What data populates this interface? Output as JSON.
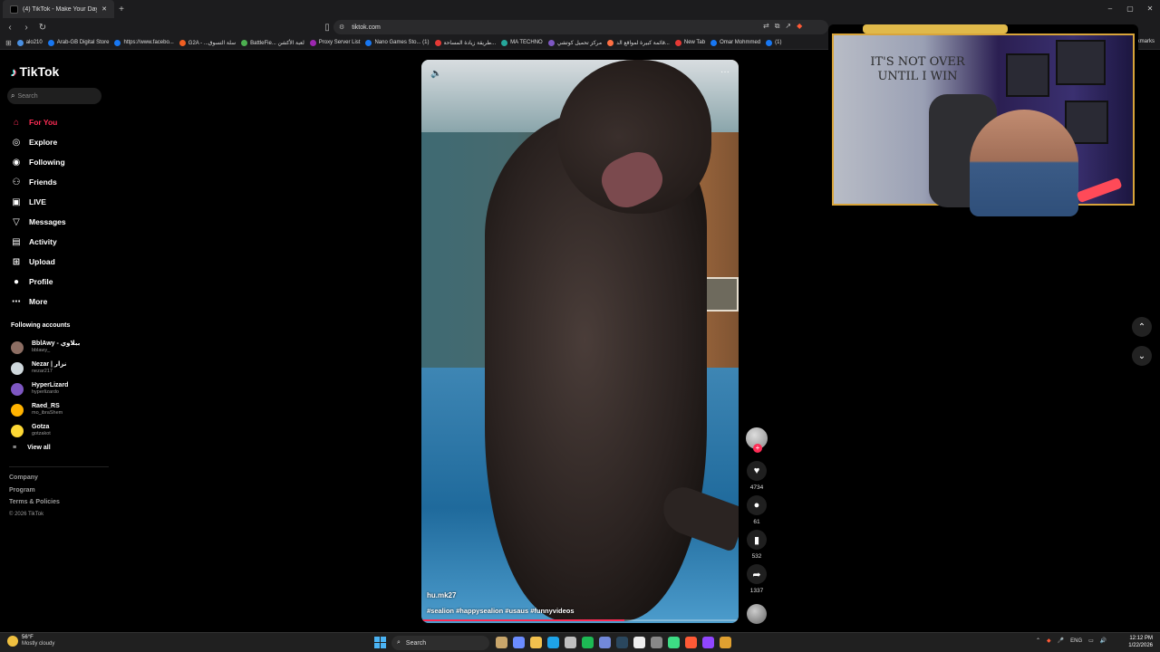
{
  "browser": {
    "tab_title": "(4) TikTok - Make Your Day",
    "new_tab_symbol": "+",
    "url": "tiktok.com",
    "window_controls": [
      "–",
      "▢",
      "✕"
    ]
  },
  "bookmarks": [
    {
      "label": "alo210",
      "color": "#4a90e2"
    },
    {
      "label": "Arab-GB Digital Store",
      "color": "#1877f2"
    },
    {
      "label": "https://www.facebo...",
      "color": "#1877f2"
    },
    {
      "label": "G2A - ...سلة التسوق",
      "color": "#f05f22"
    },
    {
      "label": "BattleFie... لعبة الأكشن",
      "color": "#4caf50"
    },
    {
      "label": "Proxy Server List",
      "color": "#9c27b0"
    },
    {
      "label": "Nano Games Sto... (1)",
      "color": "#1877f2"
    },
    {
      "label": "طريقة زيادة المساحة...",
      "color": "#e53935"
    },
    {
      "label": "MA TECHNO",
      "color": "#26a69a"
    },
    {
      "label": "مركز تحميل كوتشي",
      "color": "#7e57c2"
    },
    {
      "label": "قائمة كبيرة لمواقع الد...",
      "color": "#ff7043"
    },
    {
      "label": "New Tab",
      "color": "#e53935"
    },
    {
      "label": "Omar Mohmmed",
      "color": "#1877f2"
    },
    {
      "label": "(1)",
      "color": "#1877f2"
    }
  ],
  "bookmarks_more": "Bookmarks",
  "brand": {
    "name": "TikTok",
    "accent": "#fe2c55"
  },
  "search": {
    "placeholder": "Search"
  },
  "menu": [
    {
      "label": "For You",
      "icon": "home-icon",
      "active": true
    },
    {
      "label": "Explore",
      "icon": "compass-icon",
      "active": false
    },
    {
      "label": "Following",
      "icon": "following-icon",
      "active": false
    },
    {
      "label": "Friends",
      "icon": "friends-icon",
      "active": false
    },
    {
      "label": "LIVE",
      "icon": "live-icon",
      "active": false
    },
    {
      "label": "Messages",
      "icon": "messages-icon",
      "active": false
    },
    {
      "label": "Activity",
      "icon": "activity-icon",
      "active": false
    },
    {
      "label": "Upload",
      "icon": "upload-icon",
      "active": false
    },
    {
      "label": "Profile",
      "icon": "profile-icon",
      "active": false
    },
    {
      "label": "More",
      "icon": "more-icon",
      "active": false
    }
  ],
  "following_accounts": {
    "title": "Following accounts",
    "accounts": [
      {
        "name": "BblAwy - ببلاوي",
        "handle": "bblawy_"
      },
      {
        "name": "Nezar | نزار",
        "handle": "nezar217"
      },
      {
        "name": "HyperLizard",
        "handle": "hyperlizardo"
      },
      {
        "name": "Raed_RS",
        "handle": "mo_ibraShem"
      },
      {
        "name": "Gotza",
        "handle": "gotzakot"
      }
    ],
    "view_all": "View all"
  },
  "footer": {
    "links": [
      "Company",
      "Program",
      "Terms & Policies"
    ],
    "copyright": "© 2026 TikTok"
  },
  "video": {
    "author": "hu.mk27",
    "hashtags": "#sealion #happysealion #usaus #funnyvideos",
    "progress": 0.64
  },
  "actions": {
    "likes": "4734",
    "comments": "61",
    "saves": "532",
    "shares": "1337"
  },
  "webcam": {
    "wall_text": "IT'S NOT OVER UNTIL I WIN"
  },
  "taskbar": {
    "weather_temp": "56°F",
    "weather_desc": "Mostly cloudy",
    "search": "Search",
    "language": "ENG",
    "time": "12:12 PM",
    "date": "1/22/2026"
  }
}
